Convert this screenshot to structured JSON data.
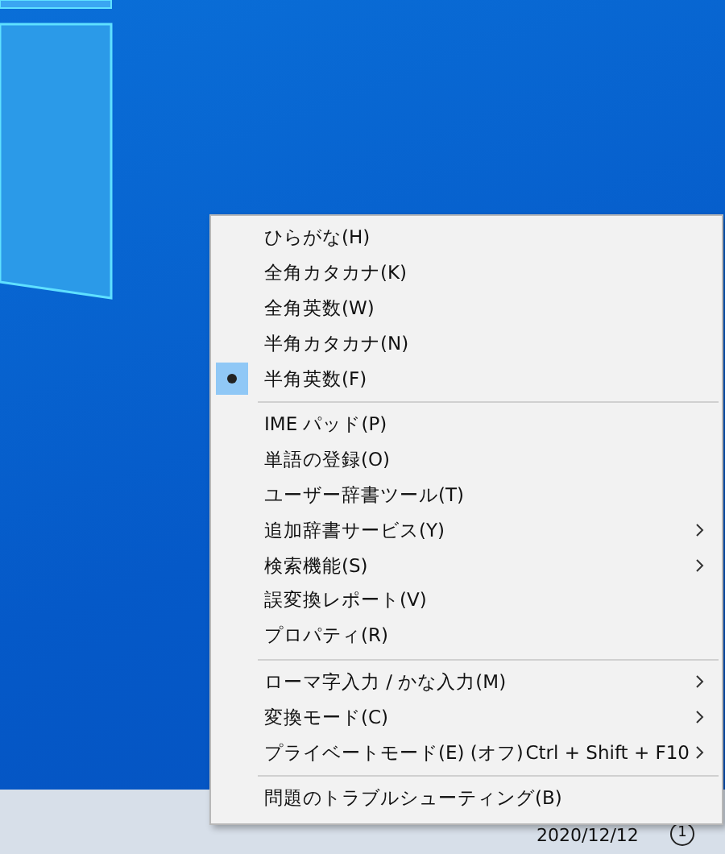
{
  "menu": {
    "groups": [
      {
        "items": [
          {
            "label": "ひらがな(H)",
            "selected": false
          },
          {
            "label": "全角カタカナ(K)",
            "selected": false
          },
          {
            "label": "全角英数(W)",
            "selected": false
          },
          {
            "label": "半角カタカナ(N)",
            "selected": false
          },
          {
            "label": "半角英数(F)",
            "selected": true
          }
        ]
      },
      {
        "items": [
          {
            "label": "IME パッド(P)",
            "submenu": false
          },
          {
            "label": "単語の登録(O)",
            "submenu": false
          },
          {
            "label": "ユーザー辞書ツール(T)",
            "submenu": false
          },
          {
            "label": "追加辞書サービス(Y)",
            "submenu": true
          },
          {
            "label": "検索機能(S)",
            "submenu": true
          },
          {
            "label": "誤変換レポート(V)",
            "submenu": false
          },
          {
            "label": "プロパティ(R)",
            "submenu": false
          }
        ]
      },
      {
        "items": [
          {
            "label": "ローマ字入力 / かな入力(M)",
            "submenu": true
          },
          {
            "label": "変換モード(C)",
            "submenu": true
          },
          {
            "label": "プライベートモード(E) (オフ)",
            "shortcut": "Ctrl + Shift + F10",
            "submenu": true
          }
        ]
      },
      {
        "items": [
          {
            "label": "問題のトラブルシューティング(B)",
            "submenu": false
          }
        ]
      }
    ]
  },
  "taskbar": {
    "date": "2020/12/12",
    "notification_count": "1"
  }
}
